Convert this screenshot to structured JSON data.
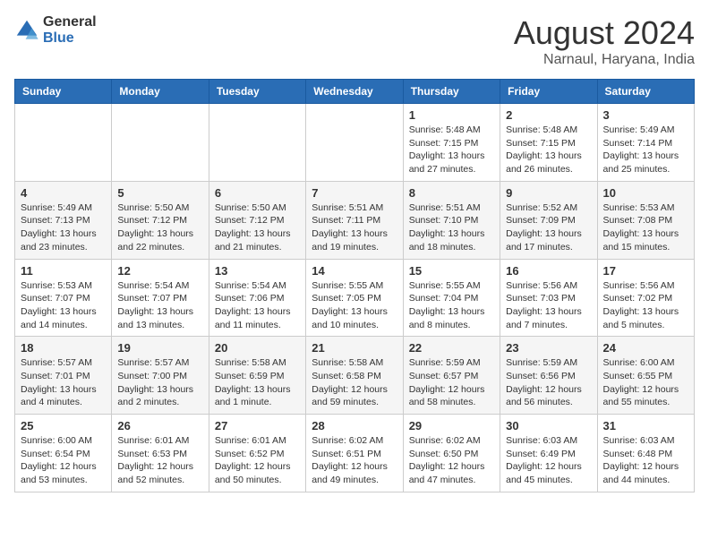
{
  "logo": {
    "general": "General",
    "blue": "Blue"
  },
  "header": {
    "month": "August 2024",
    "location": "Narnaul, Haryana, India"
  },
  "weekdays": [
    "Sunday",
    "Monday",
    "Tuesday",
    "Wednesday",
    "Thursday",
    "Friday",
    "Saturday"
  ],
  "weeks": [
    [
      {
        "day": "",
        "info": ""
      },
      {
        "day": "",
        "info": ""
      },
      {
        "day": "",
        "info": ""
      },
      {
        "day": "",
        "info": ""
      },
      {
        "day": "1",
        "info": "Sunrise: 5:48 AM\nSunset: 7:15 PM\nDaylight: 13 hours\nand 27 minutes."
      },
      {
        "day": "2",
        "info": "Sunrise: 5:48 AM\nSunset: 7:15 PM\nDaylight: 13 hours\nand 26 minutes."
      },
      {
        "day": "3",
        "info": "Sunrise: 5:49 AM\nSunset: 7:14 PM\nDaylight: 13 hours\nand 25 minutes."
      }
    ],
    [
      {
        "day": "4",
        "info": "Sunrise: 5:49 AM\nSunset: 7:13 PM\nDaylight: 13 hours\nand 23 minutes."
      },
      {
        "day": "5",
        "info": "Sunrise: 5:50 AM\nSunset: 7:12 PM\nDaylight: 13 hours\nand 22 minutes."
      },
      {
        "day": "6",
        "info": "Sunrise: 5:50 AM\nSunset: 7:12 PM\nDaylight: 13 hours\nand 21 minutes."
      },
      {
        "day": "7",
        "info": "Sunrise: 5:51 AM\nSunset: 7:11 PM\nDaylight: 13 hours\nand 19 minutes."
      },
      {
        "day": "8",
        "info": "Sunrise: 5:51 AM\nSunset: 7:10 PM\nDaylight: 13 hours\nand 18 minutes."
      },
      {
        "day": "9",
        "info": "Sunrise: 5:52 AM\nSunset: 7:09 PM\nDaylight: 13 hours\nand 17 minutes."
      },
      {
        "day": "10",
        "info": "Sunrise: 5:53 AM\nSunset: 7:08 PM\nDaylight: 13 hours\nand 15 minutes."
      }
    ],
    [
      {
        "day": "11",
        "info": "Sunrise: 5:53 AM\nSunset: 7:07 PM\nDaylight: 13 hours\nand 14 minutes."
      },
      {
        "day": "12",
        "info": "Sunrise: 5:54 AM\nSunset: 7:07 PM\nDaylight: 13 hours\nand 13 minutes."
      },
      {
        "day": "13",
        "info": "Sunrise: 5:54 AM\nSunset: 7:06 PM\nDaylight: 13 hours\nand 11 minutes."
      },
      {
        "day": "14",
        "info": "Sunrise: 5:55 AM\nSunset: 7:05 PM\nDaylight: 13 hours\nand 10 minutes."
      },
      {
        "day": "15",
        "info": "Sunrise: 5:55 AM\nSunset: 7:04 PM\nDaylight: 13 hours\nand 8 minutes."
      },
      {
        "day": "16",
        "info": "Sunrise: 5:56 AM\nSunset: 7:03 PM\nDaylight: 13 hours\nand 7 minutes."
      },
      {
        "day": "17",
        "info": "Sunrise: 5:56 AM\nSunset: 7:02 PM\nDaylight: 13 hours\nand 5 minutes."
      }
    ],
    [
      {
        "day": "18",
        "info": "Sunrise: 5:57 AM\nSunset: 7:01 PM\nDaylight: 13 hours\nand 4 minutes."
      },
      {
        "day": "19",
        "info": "Sunrise: 5:57 AM\nSunset: 7:00 PM\nDaylight: 13 hours\nand 2 minutes."
      },
      {
        "day": "20",
        "info": "Sunrise: 5:58 AM\nSunset: 6:59 PM\nDaylight: 13 hours\nand 1 minute."
      },
      {
        "day": "21",
        "info": "Sunrise: 5:58 AM\nSunset: 6:58 PM\nDaylight: 12 hours\nand 59 minutes."
      },
      {
        "day": "22",
        "info": "Sunrise: 5:59 AM\nSunset: 6:57 PM\nDaylight: 12 hours\nand 58 minutes."
      },
      {
        "day": "23",
        "info": "Sunrise: 5:59 AM\nSunset: 6:56 PM\nDaylight: 12 hours\nand 56 minutes."
      },
      {
        "day": "24",
        "info": "Sunrise: 6:00 AM\nSunset: 6:55 PM\nDaylight: 12 hours\nand 55 minutes."
      }
    ],
    [
      {
        "day": "25",
        "info": "Sunrise: 6:00 AM\nSunset: 6:54 PM\nDaylight: 12 hours\nand 53 minutes."
      },
      {
        "day": "26",
        "info": "Sunrise: 6:01 AM\nSunset: 6:53 PM\nDaylight: 12 hours\nand 52 minutes."
      },
      {
        "day": "27",
        "info": "Sunrise: 6:01 AM\nSunset: 6:52 PM\nDaylight: 12 hours\nand 50 minutes."
      },
      {
        "day": "28",
        "info": "Sunrise: 6:02 AM\nSunset: 6:51 PM\nDaylight: 12 hours\nand 49 minutes."
      },
      {
        "day": "29",
        "info": "Sunrise: 6:02 AM\nSunset: 6:50 PM\nDaylight: 12 hours\nand 47 minutes."
      },
      {
        "day": "30",
        "info": "Sunrise: 6:03 AM\nSunset: 6:49 PM\nDaylight: 12 hours\nand 45 minutes."
      },
      {
        "day": "31",
        "info": "Sunrise: 6:03 AM\nSunset: 6:48 PM\nDaylight: 12 hours\nand 44 minutes."
      }
    ]
  ]
}
